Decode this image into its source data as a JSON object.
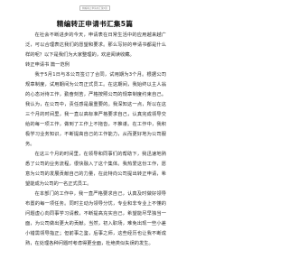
{
  "header": {
    "badge_text": "精编转正申请书汇集5篇"
  },
  "document": {
    "title": "精编转正申请书汇集5篇",
    "intro": "在社会不断进步的今天，申请表在日常生活中的应用越来越广泛，可以合理表达我们的愿望和要求。那么写好的申请书都是什么样的呢？以下是我们为大家整理的，欢迎阅读收藏。",
    "section1_heading": "转正申请书 篇一范例",
    "paragraphs": [
      "我于5月1日与本公司签订了合同，试用期为3个月。根据公司规章制度，试用期间为公司正式员工。在这期间，我始终以主人翁的心态对待工作，勤奋刻苦，严格按照公司的规章制度约束自己。我认为，在公司中，责任感是最重要的。我深知这一点，所以在这三个月的时间里，我一直以高标准严格要求自己，认真完成领导交给的每一项工作，做到了工作上不拖沓，不推诿。在工作中，我积极学习业务知识，不断提高自己的工作能力，从而更好地为公司服务。",
      "在这三个月的时间里，在领导和同事们的帮助下，我迅速地熟悉了公司的业务流程，很快融入了这个集体。我热爱这份工作，愿意为公司的发展贡献自己的力量，在此特向公司提出转正申请，希望能成为公司的一名正式员工。",
      "在本部门的工作中，我一直严格要求自己，认真及时做好领导布置的每一项任务。同时主动为领导分忧，专业和非专业上不懂的问题虚心向同事学习请教，不断提高充实自己，希望能尽早独当一面，为公司做出更大的贡献。当然，初入职场，难免出现一些小差小错需领导指正；但前事之鉴，后事之师，这些经历也让我不断成熟，在处理各种问题时考虑得更全面，杜绝类似失误的发生。"
    ]
  }
}
